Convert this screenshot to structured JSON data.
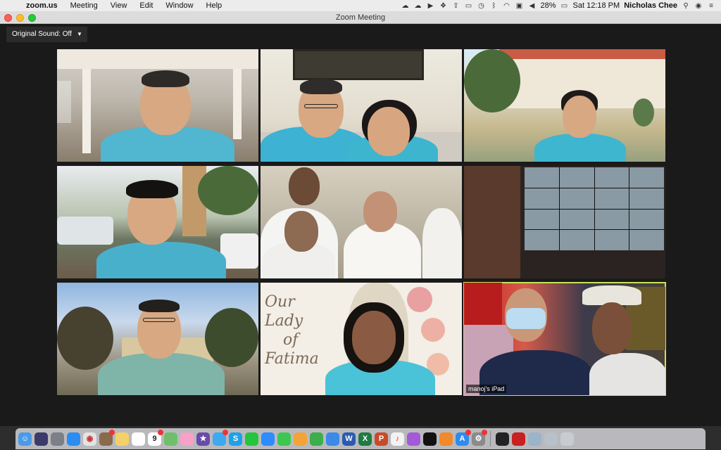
{
  "menubar": {
    "app_name": "zoom.us",
    "menus": [
      "Meeting",
      "View",
      "Edit",
      "Window",
      "Help"
    ],
    "battery": "28%",
    "clock": "Sat 12:18 PM",
    "user": "Nicholas Chee",
    "status_icons": [
      "cloud-icon",
      "cloud-icon",
      "play-icon",
      "dropbox-icon",
      "upload-icon",
      "airplay-icon",
      "time-machine-icon",
      "bluetooth-icon",
      "wifi-icon",
      "screen-icon",
      "volume-icon",
      "battery-icon"
    ]
  },
  "window": {
    "title": "Zoom Meeting"
  },
  "toolbar": {
    "original_sound_label": "Original Sound: Off"
  },
  "participants": [
    {
      "id": "p1",
      "label": ""
    },
    {
      "id": "p2",
      "label": ""
    },
    {
      "id": "p3",
      "label": ""
    },
    {
      "id": "p4",
      "label": ""
    },
    {
      "id": "p5",
      "label": ""
    },
    {
      "id": "p6",
      "label": ""
    },
    {
      "id": "p7",
      "label": ""
    },
    {
      "id": "p8",
      "label": ""
    },
    {
      "id": "p9",
      "label": "manoj's iPad",
      "active": true
    }
  ],
  "fatima_backdrop": {
    "line1": "Our Lady",
    "line2": "of",
    "line3": "Fatima"
  },
  "zoom_background": "#1a1a1a",
  "active_speaker_color": "#c8e35a",
  "dock": {
    "apps": [
      "finder",
      "siri",
      "launchpad",
      "safari",
      "chrome",
      "photos-stack",
      "notes",
      "reminders",
      "calendar",
      "maps",
      "photos",
      "imovie",
      "messages",
      "skype",
      "whatsapp",
      "zoom",
      "facetime",
      "pages",
      "numbers",
      "keynote",
      "word",
      "excel",
      "powerpoint",
      "music",
      "podcasts",
      "apple-tv",
      "books",
      "app-store",
      "system-preferences",
      "terminal",
      "acrobat",
      "preview",
      "downloads",
      "trash"
    ],
    "badges": {
      "calendar": "9"
    }
  }
}
